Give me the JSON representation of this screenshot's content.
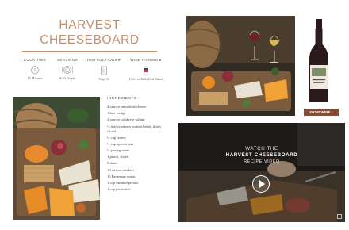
{
  "recipe": {
    "title_line1": "HARVEST",
    "title_line2": "CHEESEBOARD"
  },
  "meta": [
    {
      "heading": "COOK TIME",
      "icon": "clock-icon",
      "value": "15 Minutes"
    },
    {
      "heading": "SERVINGS",
      "icon": "plate-icon",
      "value": "8-10 People"
    },
    {
      "heading": "INSTRUCTIONS",
      "icon": "recipe-card-icon",
      "value": "Page 50"
    },
    {
      "heading": "WINE PAIRING",
      "icon": "wine-label-icon",
      "value": "Field to Table Red Blend"
    }
  ],
  "ingredients": {
    "heading": "INGREDIENTS",
    "items": [
      "4 ounces mimolette cheese",
      "1 brie wedge",
      "2 ounces calabrese salami",
      "½ loaf cranberry walnut bread, thinly sliced",
      "¼ cup honey",
      "½ cup apricot jam",
      "½ pomegranate",
      "1 peach, sliced",
      "8 dates",
      "10 artisan crackers",
      "10 Parmesan crisps",
      "1 cup candied pecans",
      "1 cup pistachios"
    ]
  },
  "shop": {
    "label": "SHOP WINE"
  },
  "video": {
    "line1": "WATCH THE",
    "line2": "HARVEST CHEESEBOARD",
    "line3": "RECIPE VIDEO"
  },
  "colors": {
    "accent": "#c58f6e",
    "button": "#8b4a2f"
  }
}
